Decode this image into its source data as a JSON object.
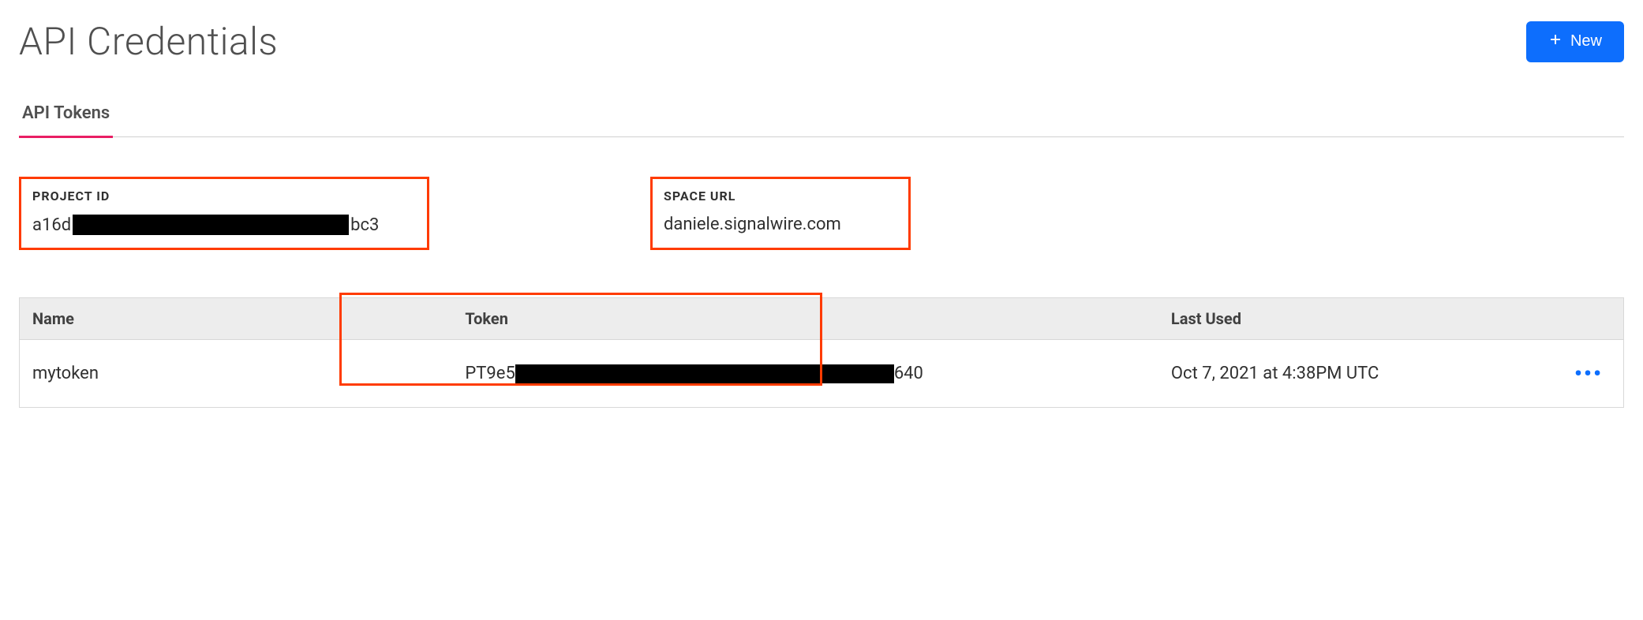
{
  "header": {
    "title": "API Credentials",
    "new_button_label": "New"
  },
  "tabs": [
    {
      "label": "API Tokens",
      "active": true
    }
  ],
  "info": {
    "project_id": {
      "label": "PROJECT ID",
      "value_prefix": "a16d",
      "value_suffix": "bc3"
    },
    "space_url": {
      "label": "SPACE URL",
      "value": "daniele.signalwire.com"
    }
  },
  "table": {
    "headers": {
      "name": "Name",
      "token": "Token",
      "last_used": "Last Used"
    },
    "rows": [
      {
        "name": "mytoken",
        "token_prefix": "PT9e5",
        "token_suffix": "640",
        "last_used": "Oct 7, 2021 at 4:38PM UTC"
      }
    ]
  }
}
